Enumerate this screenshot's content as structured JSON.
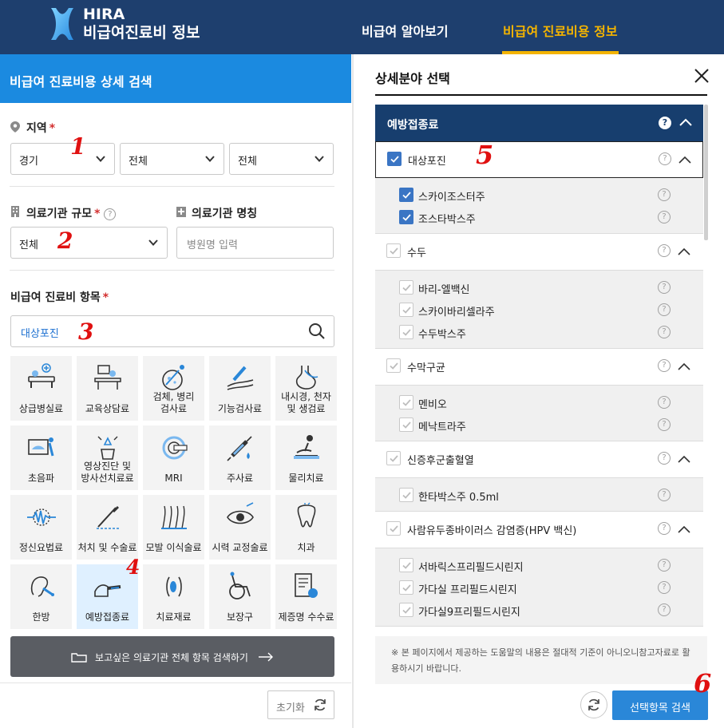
{
  "header": {
    "brand_short": "HIRA",
    "brand_title": "비급여진료비 정보",
    "nav": [
      {
        "label": "비급여 알아보기",
        "active": false
      },
      {
        "label": "비급여 진료비용 정보",
        "active": true
      }
    ]
  },
  "left": {
    "panel_title": "비급여 진료비용 상세 검색",
    "region": {
      "label": "지역",
      "required_mark": "*",
      "selects": [
        "경기",
        "전체",
        "전체"
      ]
    },
    "scale": {
      "label": "의료기관 규모",
      "required_mark": "*",
      "help": "?",
      "value": "전체"
    },
    "name": {
      "label": "의료기관 명칭",
      "placeholder": "병원명 입력"
    },
    "items": {
      "label": "비급여 진료비 항목",
      "required_mark": "*",
      "search_value": "대상포진"
    },
    "categories": [
      {
        "label": "상급병실료",
        "icon": "hospital-bed-icon"
      },
      {
        "label": "교육상담료",
        "icon": "counseling-desk-icon"
      },
      {
        "label": "검체, 병리\n검사료",
        "icon": "microscope-icon"
      },
      {
        "label": "기능검사료",
        "icon": "arm-test-icon"
      },
      {
        "label": "내시경, 천자\n및 생검료",
        "icon": "stomach-icon"
      },
      {
        "label": "초음파",
        "icon": "ultrasound-icon"
      },
      {
        "label": "영상진단 및\n방사선치료료",
        "icon": "radiology-icon"
      },
      {
        "label": "MRI",
        "icon": "mri-icon"
      },
      {
        "label": "주사료",
        "icon": "syringe-icon"
      },
      {
        "label": "물리치료",
        "icon": "physio-icon"
      },
      {
        "label": "정신요법료",
        "icon": "brain-wave-icon"
      },
      {
        "label": "처치 및 수술료",
        "icon": "surgery-icon"
      },
      {
        "label": "모발 이식술료",
        "icon": "hair-icon"
      },
      {
        "label": "시력 교정술료",
        "icon": "eye-icon"
      },
      {
        "label": "치과",
        "icon": "tooth-icon"
      },
      {
        "label": "한방",
        "icon": "acupuncture-icon"
      },
      {
        "label": "예방접종료",
        "icon": "vaccine-icon",
        "selected": true
      },
      {
        "label": "치료재료",
        "icon": "material-icon"
      },
      {
        "label": "보장구",
        "icon": "wheelchair-icon"
      },
      {
        "label": "제증명 수수료",
        "icon": "certificate-icon"
      }
    ],
    "all_search_button": "보고싶은 의료기관 전체 항목 검색하기",
    "reset_button": "초기화",
    "annotations": [
      "1",
      "2",
      "3",
      "4"
    ]
  },
  "right": {
    "title": "상세분야 선택",
    "category_head": "예방접종료",
    "help": "?",
    "groups": [
      {
        "label": "대상포진",
        "checked": true,
        "items": [
          {
            "label": "스카이조스터주",
            "checked": true
          },
          {
            "label": "조스타박스주",
            "checked": true
          }
        ]
      },
      {
        "label": "수두",
        "checked": false,
        "items": [
          {
            "label": "바리-엘백신",
            "checked": false
          },
          {
            "label": "스카이바리셀라주",
            "checked": false
          },
          {
            "label": "수두박스주",
            "checked": false
          }
        ]
      },
      {
        "label": "수막구균",
        "checked": false,
        "items": [
          {
            "label": "멘비오",
            "checked": false
          },
          {
            "label": "메낙트라주",
            "checked": false
          }
        ]
      },
      {
        "label": "신증후군출혈열",
        "checked": false,
        "items": [
          {
            "label": "한타박스주 0.5ml",
            "checked": false
          }
        ]
      },
      {
        "label": "사람유두종바이러스 감염증(HPV 백신)",
        "checked": false,
        "items": [
          {
            "label": "서바릭스프리필드시린지",
            "checked": false
          },
          {
            "label": "가다실 프리필드시린지",
            "checked": false
          },
          {
            "label": "가다실9프리필드시린지",
            "checked": false
          }
        ]
      }
    ],
    "notice": "※ 본 페이지에서 제공하는 도움말의 내용은 절대적 기준이 아니오니참고자료로 활용하시기 바랍니다.",
    "apply_button": "선택항목 검색",
    "annotations": [
      "5",
      "6"
    ]
  },
  "colors": {
    "header_bg": "#1e3f6e",
    "accent_yellow": "#f4b400",
    "panel_blue": "#1b8ae0",
    "category_navy": "#173e6e",
    "check_blue": "#3a75c4",
    "annotation_red": "#e01010"
  }
}
